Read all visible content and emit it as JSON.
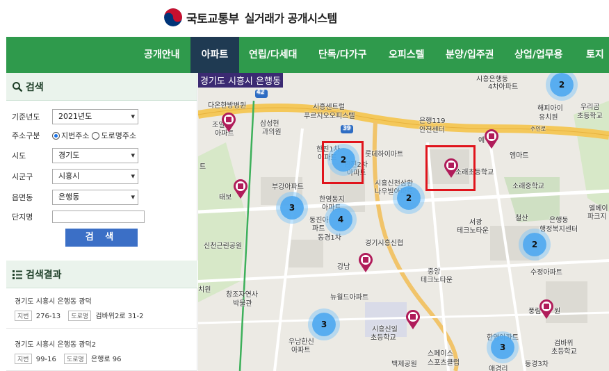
{
  "header": {
    "ministry": "국토교통부",
    "system_title": "실거래가 공개시스템",
    "colors": {
      "brand_red": "#c8102e",
      "brand_blue": "#003478"
    }
  },
  "nav": {
    "items": [
      "공개안내",
      "아파트",
      "연립/다세대",
      "단독/다가구",
      "오피스텔",
      "분양/입주권",
      "상업/업무용",
      "토지"
    ],
    "active": "아파트",
    "colors": {
      "bar": "#2f9a4c",
      "active": "#1f3a52"
    }
  },
  "search": {
    "title": "검색",
    "icon": "search-icon",
    "year_label": "기준년도",
    "year_value": "2021년도",
    "addr_type_label": "주소구분",
    "addr_opt1": "지번주소",
    "addr_opt2": "도로명주소",
    "addr_selected": "지번주소",
    "sido_label": "시도",
    "sido_value": "경기도",
    "sigungu_label": "시군구",
    "sigungu_value": "시흥시",
    "eupmyeondong_label": "읍면동",
    "eupmyeondong_value": "은행동",
    "complex_label": "단지명",
    "complex_value": "",
    "button": "검 색"
  },
  "results": {
    "title": "검색결과",
    "icon": "list-icon",
    "items": [
      {
        "address": "경기도 시흥시 은행동 광덕",
        "jibun_tag": "지번",
        "jibun": "276-13",
        "road_tag": "도로명",
        "road": "검바위2로 31-2"
      },
      {
        "address": "경기도 시흥시 은행동 광덕2",
        "jibun_tag": "지번",
        "jibun": "99-16",
        "road_tag": "도로명",
        "road": "은행로 96"
      }
    ]
  },
  "map": {
    "title": "경기도 시흥시 은행동",
    "labels": [
      "다온한방병원",
      "시흥센트럴",
      "푸르지오오피스텔",
      "시흥은행동",
      "4차아파트",
      "해피아이",
      "유치원",
      "우리곰",
      "초등학교",
      "조일",
      "아파트",
      "삼성현",
      "과의원",
      "은행119",
      "안전센터",
      "수인로",
      "롯데하이마트",
      "한진1차",
      "아파트",
      "한진2차",
      "아파트",
      "예",
      "엠마트",
      "소래초등학교",
      "트",
      "부강아파트",
      "시흥신천삼환",
      "나우빌아파트",
      "소래중학교",
      "태보",
      "한영동지",
      "아파트",
      "동진아",
      "파트",
      "서광",
      "테크노타운",
      "철산",
      "은행동",
      "행정복지센터",
      "엘베이",
      "파크지",
      "동경1차",
      "경기시흥신협",
      "신천근린공원",
      "강남",
      "수정아파트",
      "중앙",
      "테크노타운",
      "치원",
      "창조자연사",
      "박물관",
      "뉴월드아파트",
      "시흥신일",
      "초등학교",
      "풍림",
      "원",
      "우남한신",
      "아파트",
      "스페이스",
      "스포츠클럽",
      "백제공원",
      "한영아파트",
      "검바위",
      "초등학교",
      "동경3차",
      "애경리"
    ],
    "clusters": [
      "2",
      "2",
      "3",
      "2",
      "4",
      "2",
      "3",
      "3"
    ],
    "road_badges": [
      "42",
      "39"
    ],
    "highlight_color": "#e0141c"
  }
}
